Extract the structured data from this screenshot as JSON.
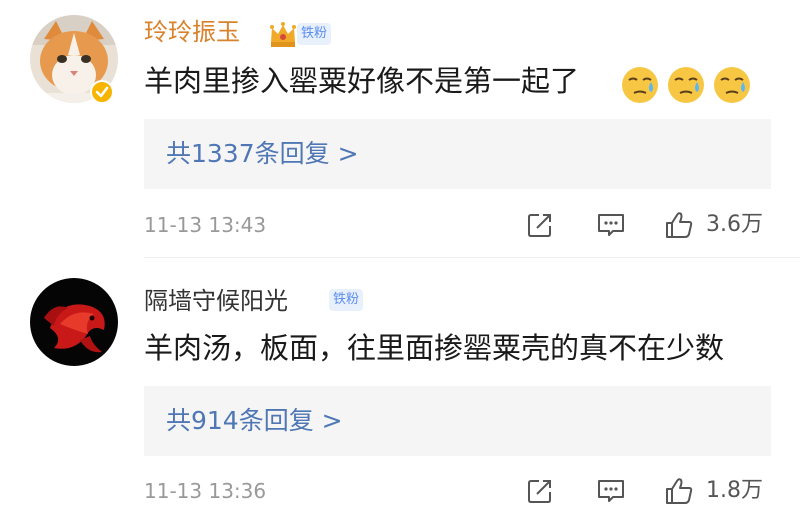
{
  "comments": [
    {
      "username": "玲玲振玉",
      "badge": "铁粉",
      "content": "羊肉里掺入罂粟好像不是第一起了",
      "replies_label": "共1337条回复 >",
      "timestamp": "11-13 13:43",
      "likes": "3.6万",
      "avatar_icon": "orange-cat-avatar",
      "reaction_icon": "sweat-face-emoji",
      "reaction_count": 3
    },
    {
      "username": "隔墙守候阳光",
      "badge": "铁粉",
      "content": "羊肉汤，板面，往里面掺罂粟壳的真不在少数",
      "replies_label": "共914条回复 >",
      "timestamp": "11-13 13:36",
      "likes": "1.8万",
      "avatar_icon": "red-betta-fish-avatar"
    }
  ],
  "colors": {
    "vip_username": "#d9822b",
    "username": "#333333",
    "reply_link": "#5077b5",
    "badge_text": "#5b8def",
    "badge_bg": "#e8f0fc",
    "reply_box_bg": "#f5f5f5",
    "meta_text": "#999999"
  },
  "icons": {
    "share": "share-icon",
    "reply": "comment-icon",
    "like": "thumbs-up-icon",
    "vip": "crown-icon",
    "verified": "verified-badge-icon"
  }
}
